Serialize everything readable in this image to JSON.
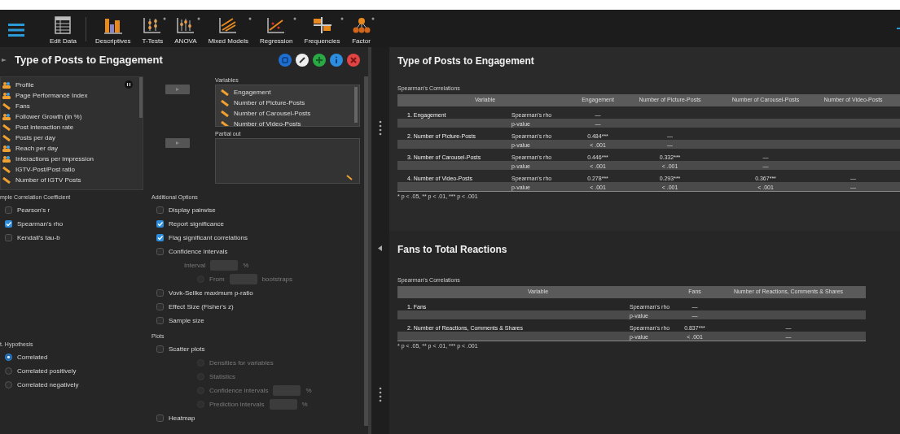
{
  "toolbar": {
    "items": [
      {
        "label": "Edit Data",
        "kind": "table",
        "dropdown": false
      },
      {
        "label": "Descriptives",
        "kind": "bars",
        "dropdown": false
      },
      {
        "label": "T-Tests",
        "kind": "ttest",
        "dropdown": true
      },
      {
        "label": "ANOVA",
        "kind": "anova",
        "dropdown": true
      },
      {
        "label": "Mixed Models",
        "kind": "mixed",
        "dropdown": true
      },
      {
        "label": "Regression",
        "kind": "regression",
        "dropdown": true
      },
      {
        "label": "Frequencies",
        "kind": "frequencies",
        "dropdown": true
      },
      {
        "label": "Factor",
        "kind": "factor",
        "dropdown": true
      }
    ]
  },
  "analysis": {
    "title": "Type of Posts to Engagement",
    "available_variables": [
      {
        "name": "Profile",
        "kind": "nominal"
      },
      {
        "name": "Page Performance Index",
        "kind": "nominal"
      },
      {
        "name": "Fans",
        "kind": "scale"
      },
      {
        "name": "Follower Growth (in %)",
        "kind": "nominal"
      },
      {
        "name": "Post interaction rate",
        "kind": "scale"
      },
      {
        "name": "Posts per day",
        "kind": "scale"
      },
      {
        "name": "Reach per day",
        "kind": "nominal"
      },
      {
        "name": "Interactions per impression",
        "kind": "nominal"
      },
      {
        "name": "IGTV-Post/Post ratio",
        "kind": "scale"
      },
      {
        "name": "Number of IGTV Posts",
        "kind": "scale"
      }
    ],
    "variables_label": "Variables",
    "variables": [
      {
        "name": "Engagement",
        "kind": "scale"
      },
      {
        "name": "Number of Picture-Posts",
        "kind": "scale"
      },
      {
        "name": "Number of Carousel-Posts",
        "kind": "scale"
      },
      {
        "name": "Number of Video-Posts",
        "kind": "scale"
      }
    ],
    "partial_label": "Partial out",
    "coefficient": {
      "label": "mple Correlation Coefficient",
      "options": [
        {
          "label": "Pearson's r",
          "checked": false
        },
        {
          "label": "Spearman's rho",
          "checked": true
        },
        {
          "label": "Kendall's tau-b",
          "checked": false
        }
      ]
    },
    "additional": {
      "label": "Additional Options",
      "options": [
        {
          "label": "Display pairwise",
          "checked": false
        },
        {
          "label": "Report significance",
          "checked": true
        },
        {
          "label": "Flag significant correlations",
          "checked": true
        },
        {
          "label": "Confidence intervals",
          "checked": false,
          "children": [
            {
              "label": "Interval",
              "kind": "field",
              "unit": "%",
              "disabled": true
            },
            {
              "label": "From",
              "kind": "radio_field",
              "unit": "bootstraps",
              "disabled": true,
              "selected": false
            }
          ]
        },
        {
          "label": "Vovk-Sellke maximum p-ratio",
          "checked": false
        },
        {
          "label": "Effect Size (Fisher's z)",
          "checked": false
        },
        {
          "label": "Sample size",
          "checked": false
        }
      ]
    },
    "hypothesis": {
      "label": "t. Hypothesis",
      "options": [
        {
          "label": "Correlated",
          "selected": true
        },
        {
          "label": "Correlated positively",
          "selected": false
        },
        {
          "label": "Correlated negatively",
          "selected": false
        }
      ]
    },
    "plots": {
      "label": "Plots",
      "options": [
        {
          "label": "Scatter plots",
          "checked": false,
          "children": [
            {
              "label": "Densities for variables",
              "kind": "radio",
              "disabled": true,
              "selected": false
            },
            {
              "label": "Statistics",
              "kind": "radio",
              "disabled": true,
              "selected": false
            },
            {
              "label": "Confidence intervals",
              "kind": "radio_field",
              "unit": "%",
              "disabled": true,
              "selected": false
            },
            {
              "label": "Prediction intervals",
              "kind": "radio_field",
              "unit": "%",
              "disabled": true,
              "selected": false
            }
          ]
        },
        {
          "label": "Heatmap",
          "checked": false
        }
      ]
    }
  },
  "results": [
    {
      "title": "Type of Posts to Engagement",
      "table_title": "Spearman's Correlations",
      "columns": [
        "Variable",
        "Engagement",
        "Number of Picture-Posts",
        "Number of Carousel-Posts",
        "Number of Video-Posts"
      ],
      "rows": [
        {
          "variable": "1. Engagement",
          "rho_label": "Spearman's rho",
          "p_label": "p-value",
          "rho": [
            "—"
          ],
          "p": [
            "—"
          ]
        },
        {
          "variable": "2. Number of Picture-Posts",
          "rho_label": "Spearman's rho",
          "p_label": "p-value",
          "rho": [
            "0.484***",
            "—"
          ],
          "p": [
            "< .001",
            "—"
          ]
        },
        {
          "variable": "3. Number of Carousel-Posts",
          "rho_label": "Spearman's rho",
          "p_label": "p-value",
          "rho": [
            "0.446***",
            "0.332***",
            "—"
          ],
          "p": [
            "< .001",
            "< .001",
            "—"
          ]
        },
        {
          "variable": "4. Number of Video-Posts",
          "rho_label": "Spearman's rho",
          "p_label": "p-value",
          "rho": [
            "0.278***",
            "0.293***",
            "0.367***",
            "—"
          ],
          "p": [
            "< .001",
            "< .001",
            "< .001",
            "—"
          ]
        }
      ],
      "footnote": "* p < .05, ** p < .01, *** p < .001"
    },
    {
      "title": "Fans to Total Reactions",
      "table_title": "Spearman's Correlations",
      "columns": [
        "Variable",
        "Fans",
        "Number of Reactions, Comments & Shares"
      ],
      "rows": [
        {
          "variable": "1. Fans",
          "rho_label": "Spearman's rho",
          "p_label": "p-value",
          "rho": [
            "—"
          ],
          "p": [
            "—"
          ]
        },
        {
          "variable": "2. Number of Reactions, Comments & Shares",
          "rho_label": "Spearman's rho",
          "p_label": "p-value",
          "rho": [
            "0.837***",
            "—"
          ],
          "p": [
            "< .001",
            "—"
          ]
        }
      ],
      "footnote": "* p < .05, ** p < .01, *** p < .001"
    }
  ]
}
